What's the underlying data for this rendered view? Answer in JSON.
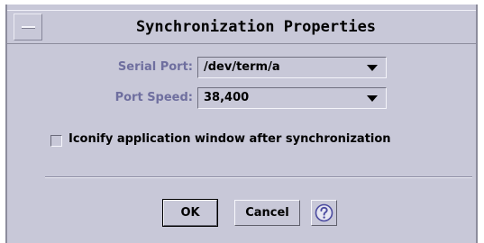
{
  "window": {
    "title": "Synchronization Properties"
  },
  "serial_port": {
    "label": "Serial Port:",
    "value": "/dev/term/a"
  },
  "port_speed": {
    "label": "Port Speed:",
    "value": "38,400"
  },
  "iconify": {
    "label": "Iconify application window after synchronization",
    "checked": false
  },
  "buttons": {
    "ok": "OK",
    "cancel": "Cancel",
    "help_icon": "question-mark-icon"
  },
  "colors": {
    "background": "#c8c8d8",
    "label_text": "#6f6f9f",
    "help_accent": "#4b4ba0"
  }
}
